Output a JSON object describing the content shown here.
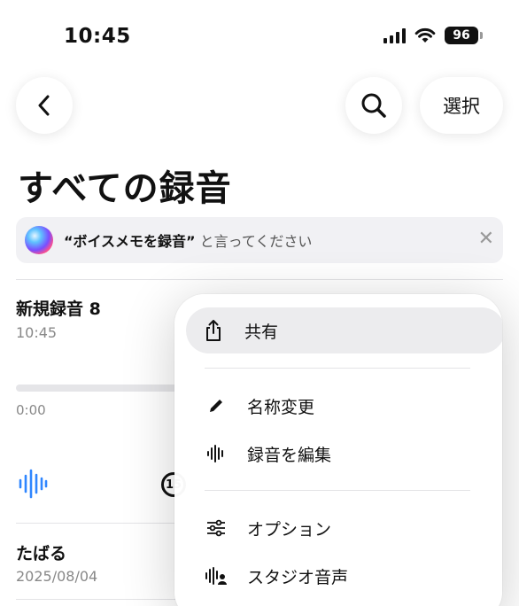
{
  "status_bar": {
    "time": "10:45",
    "battery": "96"
  },
  "nav": {
    "back_icon": "chevron-left-icon",
    "search_icon": "search-icon",
    "select_label": "選択"
  },
  "page": {
    "title": "すべての録音"
  },
  "siri_banner": {
    "quote_bold": "“ボイスメモを録音”",
    "text": " と言ってください",
    "close": "✕"
  },
  "recording": {
    "title": "新規録音 8",
    "time": "10:45",
    "elapsed": "0:00",
    "progress": 0.0,
    "skip_label": "15"
  },
  "list": [
    {
      "title": "たばる",
      "date": "2025/08/04"
    }
  ],
  "context_menu": {
    "items": [
      {
        "label": "共有",
        "icon": "share-icon"
      },
      {
        "label": "名称変更",
        "icon": "pencil-icon"
      },
      {
        "label": "録音を編集",
        "icon": "waveform-icon"
      },
      {
        "label": "オプション",
        "icon": "sliders-icon"
      },
      {
        "label": "スタジオ音声",
        "icon": "waveform-person-icon"
      }
    ]
  },
  "colors": {
    "accent": "#2f86ff",
    "banner_bg": "#f1f1f4",
    "muted_text": "#888888"
  }
}
